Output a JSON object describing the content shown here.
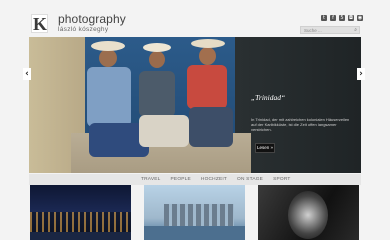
{
  "brand": {
    "logo_letter": "K",
    "title": "photography",
    "subtitle": "lászló kószeghy"
  },
  "social_icons": [
    "twitter-icon",
    "facebook-icon",
    "500px-icon",
    "instagram-icon",
    "rss-icon"
  ],
  "search": {
    "placeholder": "Suche ..."
  },
  "hero": {
    "caption_title": "„Trinidad“",
    "caption_text": "In Trinidad, der mit zahlreichen kolonialen Häuserzeilen auf der Karibikküste, ist die Zeit offen langsamer verstrichen.",
    "button_label": "Lesen »",
    "prev_label": "‹",
    "next_label": "›"
  },
  "nav": {
    "items": [
      "TRAVEL",
      "PEOPLE",
      "HOCHZEIT",
      "ON STAGE",
      "SPORT"
    ]
  },
  "thumbnails": [
    "city-at-night",
    "river-skyline",
    "wedding-couple"
  ]
}
